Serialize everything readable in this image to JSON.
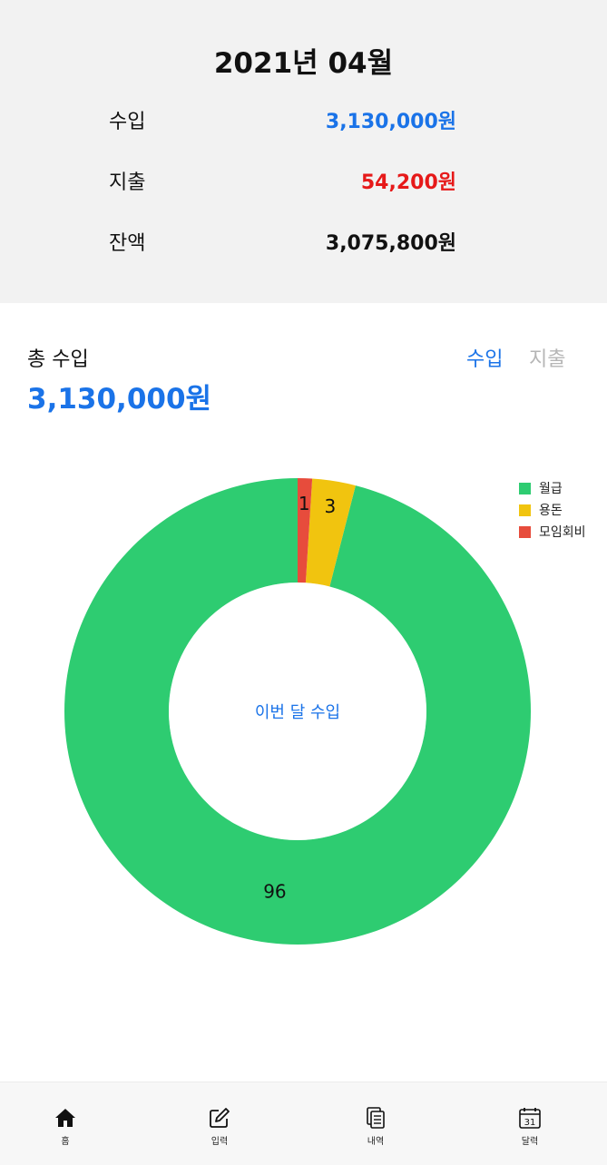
{
  "header": {
    "month": "2021년 04월",
    "income_label": "수입",
    "income_value": "3,130,000원",
    "expense_label": "지출",
    "expense_value": "54,200원",
    "balance_label": "잔액",
    "balance_value": "3,075,800원"
  },
  "main": {
    "total_label": "총 수입",
    "total_value": "3,130,000원",
    "toggle_income": "수입",
    "toggle_expense": "지출",
    "center_text": "이번 달 수입"
  },
  "colors": {
    "income": "#1a73e8",
    "expense": "#e61919",
    "toggle_inactive": "#b5b5b5"
  },
  "chart_data": {
    "type": "pie",
    "title": "",
    "categories": [
      "월급",
      "용돈",
      "모임회비"
    ],
    "values": [
      96,
      3,
      1
    ],
    "labels": [
      "96",
      "3",
      "1"
    ],
    "colors": [
      "#2ecc71",
      "#f1c40f",
      "#e74c3c"
    ],
    "legend_position": "top-right",
    "donut": true
  },
  "nav": {
    "items": [
      {
        "label": "홈",
        "icon": "home-icon"
      },
      {
        "label": "입력",
        "icon": "edit-icon"
      },
      {
        "label": "내역",
        "icon": "document-list-icon"
      },
      {
        "label": "달력",
        "icon": "calendar-icon"
      }
    ],
    "calendar_day": "31"
  }
}
